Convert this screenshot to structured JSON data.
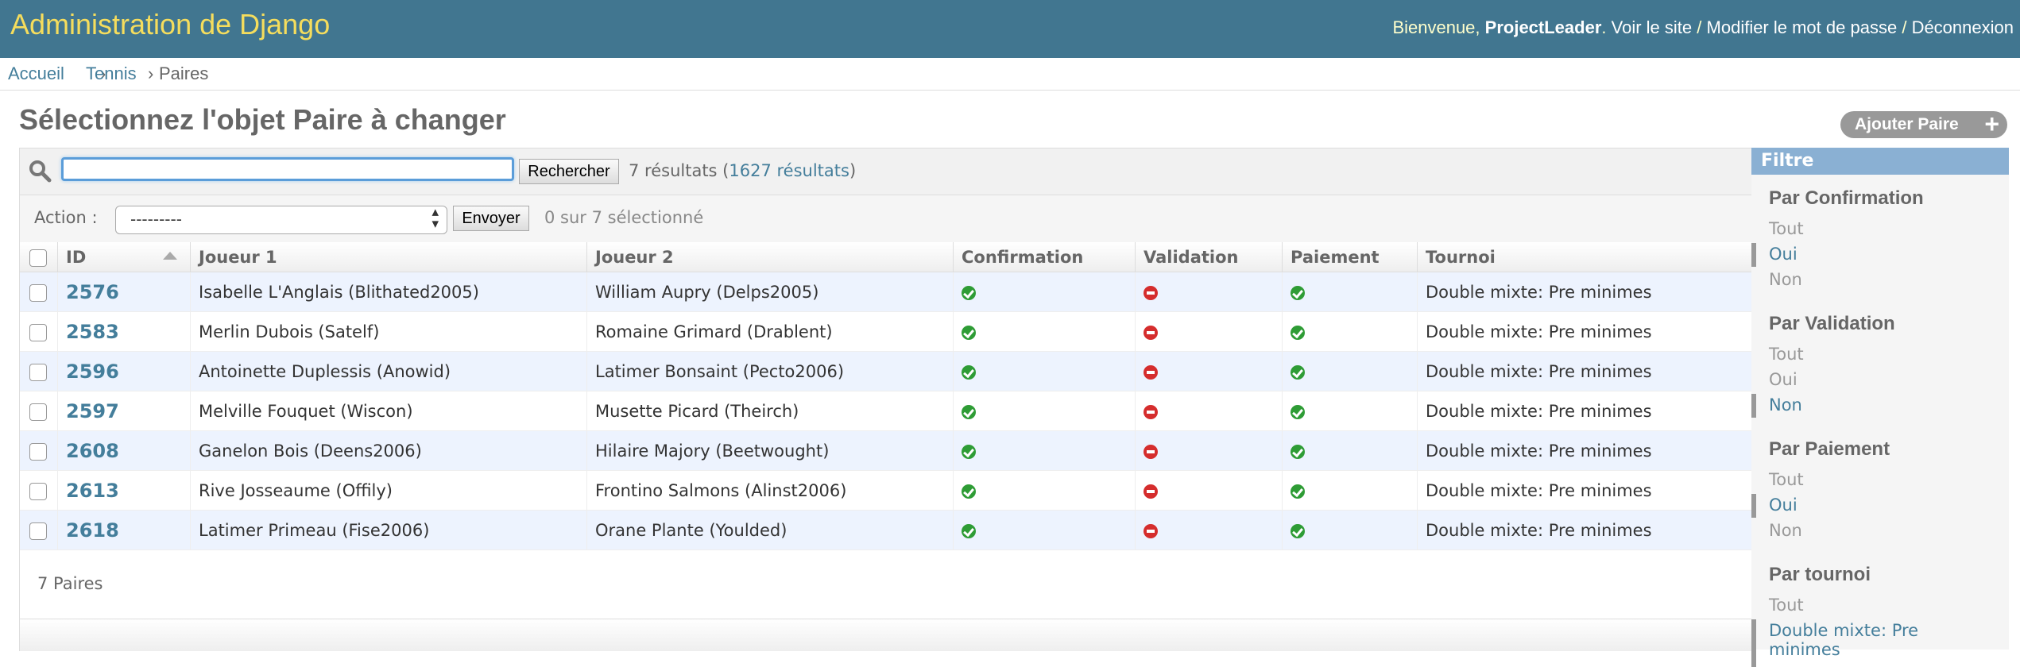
{
  "header": {
    "site_name": "Administration de Django",
    "welcome": "Bienvenue,",
    "username": "ProjectLeader",
    "view_site": "Voir le site",
    "change_password": "Modifier le mot de passe",
    "logout": "Déconnexion",
    "separator": "/"
  },
  "breadcrumbs": {
    "home": "Accueil",
    "app": "Tennis",
    "current": "Paires",
    "sep": "›"
  },
  "page": {
    "title": "Sélectionnez l'objet Paire à changer",
    "add_button": "Ajouter Paire"
  },
  "search": {
    "button": "Rechercher",
    "value": "",
    "results_prefix": "7 résultats (",
    "total_link": "1627 résultats",
    "results_suffix": ")"
  },
  "actions": {
    "label": "Action :",
    "selected": "---------",
    "go": "Envoyer",
    "counter": "0 sur 7 sélectionné"
  },
  "columns": [
    "ID",
    "Joueur 1",
    "Joueur 2",
    "Confirmation",
    "Validation",
    "Paiement",
    "Tournoi"
  ],
  "rows": [
    {
      "id": "2576",
      "j1": "Isabelle L'Anglais (Blithated2005)",
      "j2": "William Aupry (Delps2005)",
      "confirmation": true,
      "validation": false,
      "paiement": true,
      "tournoi": "Double mixte: Pre minimes"
    },
    {
      "id": "2583",
      "j1": "Merlin Dubois (Satelf)",
      "j2": "Romaine Grimard (Drablent)",
      "confirmation": true,
      "validation": false,
      "paiement": true,
      "tournoi": "Double mixte: Pre minimes"
    },
    {
      "id": "2596",
      "j1": "Antoinette Duplessis (Anowid)",
      "j2": "Latimer Bonsaint (Pecto2006)",
      "confirmation": true,
      "validation": false,
      "paiement": true,
      "tournoi": "Double mixte: Pre minimes"
    },
    {
      "id": "2597",
      "j1": "Melville Fouquet (Wiscon)",
      "j2": "Musette Picard (Theirch)",
      "confirmation": true,
      "validation": false,
      "paiement": true,
      "tournoi": "Double mixte: Pre minimes"
    },
    {
      "id": "2608",
      "j1": "Ganelon Bois (Deens2006)",
      "j2": "Hilaire Majory (Beetwought)",
      "confirmation": true,
      "validation": false,
      "paiement": true,
      "tournoi": "Double mixte: Pre minimes"
    },
    {
      "id": "2613",
      "j1": "Rive Josseaume (Offily)",
      "j2": "Frontino Salmons (Alinst2006)",
      "confirmation": true,
      "validation": false,
      "paiement": true,
      "tournoi": "Double mixte: Pre minimes"
    },
    {
      "id": "2618",
      "j1": "Latimer Primeau (Fise2006)",
      "j2": "Orane Plante (Youlded)",
      "confirmation": true,
      "validation": false,
      "paiement": true,
      "tournoi": "Double mixte: Pre minimes"
    }
  ],
  "paginator": "7 Paires",
  "filter": {
    "title": "Filtre",
    "groups": [
      {
        "title": "Par Confirmation",
        "items": [
          "Tout",
          "Oui",
          "Non"
        ],
        "selected": 1
      },
      {
        "title": "Par Validation",
        "items": [
          "Tout",
          "Oui",
          "Non"
        ],
        "selected": 2
      },
      {
        "title": "Par Paiement",
        "items": [
          "Tout",
          "Oui",
          "Non"
        ],
        "selected": 1
      },
      {
        "title": "Par tournoi",
        "items": [
          "Tout",
          "Double mixte: Pre minimes"
        ],
        "selected": 1
      }
    ]
  },
  "icons": {
    "search": "magnifier-icon",
    "yes": "check-circle-icon",
    "no": "minus-circle-icon",
    "add": "plus-icon",
    "sort": "sort-ascending-icon"
  },
  "colors": {
    "header_bg": "#417690",
    "site_name": "#f5dd5d",
    "link": "#447e9b",
    "row_alt": "#edf3fe",
    "filter_head": "#8ab0d3",
    "yes": "#2e9c35",
    "no": "#d52d2d"
  }
}
